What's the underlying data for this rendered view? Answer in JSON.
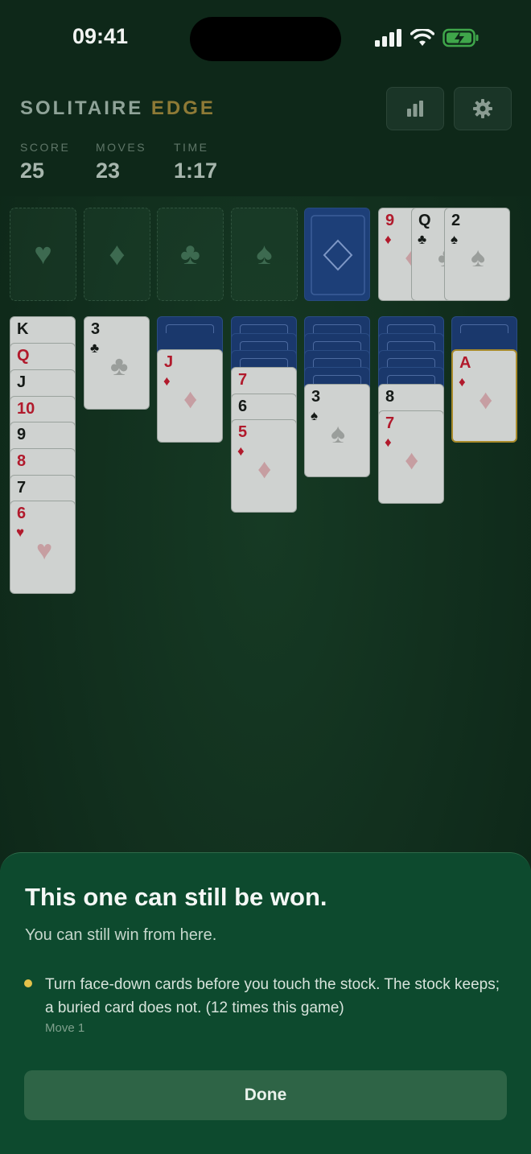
{
  "status_bar": {
    "time": "09:41"
  },
  "header": {
    "title_main": "SOLITAIRE",
    "title_accent": "EDGE",
    "stats_button_icon": "bar-chart-icon",
    "settings_button_icon": "gear-icon"
  },
  "stats": {
    "score_label": "SCORE",
    "score_value": "25",
    "moves_label": "MOVES",
    "moves_value": "23",
    "time_label": "TIME",
    "time_value": "1:17"
  },
  "foundations": [
    {
      "suit": "hearts",
      "icon": "heart-icon",
      "glyph": "♥"
    },
    {
      "suit": "diamonds",
      "icon": "diamond-icon",
      "glyph": "♦"
    },
    {
      "suit": "clubs",
      "icon": "club-icon",
      "glyph": "♣"
    },
    {
      "suit": "spades",
      "icon": "spade-icon",
      "glyph": "♠"
    }
  ],
  "waste": [
    {
      "rank": "9",
      "suit": "♦",
      "color": "red"
    },
    {
      "rank": "Q",
      "suit": "♣",
      "color": "black"
    },
    {
      "rank": "2",
      "suit": "♠",
      "color": "black"
    }
  ],
  "tableau": {
    "col1": [
      {
        "rank": "K",
        "suit": "",
        "color": "black"
      },
      {
        "rank": "Q",
        "suit": "",
        "color": "red"
      },
      {
        "rank": "J",
        "suit": "",
        "color": "black"
      },
      {
        "rank": "10",
        "suit": "",
        "color": "red"
      },
      {
        "rank": "9",
        "suit": "",
        "color": "black"
      },
      {
        "rank": "8",
        "suit": "",
        "color": "red"
      },
      {
        "rank": "7",
        "suit": "",
        "color": "black"
      },
      {
        "rank": "6",
        "suit": "♥",
        "color": "red"
      }
    ],
    "col2": [
      {
        "rank": "3",
        "suit": "♣",
        "color": "black"
      }
    ],
    "col3": [
      {
        "rank": "J",
        "suit": "♦",
        "color": "red"
      }
    ],
    "col4": [
      {
        "rank": "7",
        "suit": "",
        "color": "red"
      },
      {
        "rank": "6",
        "suit": "",
        "color": "black"
      },
      {
        "rank": "5",
        "suit": "♦",
        "color": "red"
      }
    ],
    "col5": [
      {
        "rank": "3",
        "suit": "♠",
        "color": "black"
      }
    ],
    "col6": [
      {
        "rank": "8",
        "suit": "",
        "color": "black"
      },
      {
        "rank": "7",
        "suit": "♦",
        "color": "red"
      }
    ],
    "col7": [
      {
        "rank": "A",
        "suit": "♦",
        "color": "red"
      }
    ]
  },
  "sheet": {
    "title": "This one can still be won.",
    "subtitle": "You can still win from here.",
    "tip_text": "Turn face-down cards before you touch the stock. The stock keeps; a buried card does not. (12 times this game)",
    "tip_meta": "Move 1",
    "done_label": "Done"
  },
  "colors": {
    "accent_gold": "#8e7a36",
    "card_red": "#b11a2c",
    "card_back": "#1d3f78",
    "sheet_bg": "#0d4a2e",
    "tip_dot": "#e3c24a"
  }
}
